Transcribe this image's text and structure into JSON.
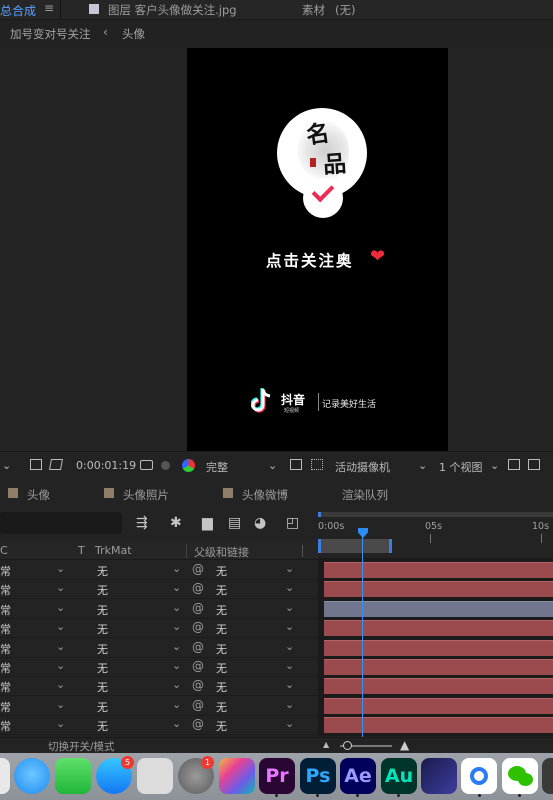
{
  "title_bar": {
    "active_tab": "总合成",
    "menu_glyph": "≡",
    "layer_tab": "图层 客户头像做关注.jpg",
    "footage_tab": "素材",
    "footage_value": "(无)"
  },
  "breadcrumb": {
    "item1": "加号变对号关注",
    "arrow": "‹",
    "item2": "头像"
  },
  "canvas": {
    "logo_char1": "名",
    "logo_char2": "品",
    "cta_text": "点击关注奥",
    "cta_heart": "❤",
    "app_name": "抖音",
    "app_sub": "短视频",
    "slogan": "记录美好生活"
  },
  "viewer_toolbar": {
    "timecode": "0:00:01:19",
    "resolution": "完整",
    "camera": "活动摄像机",
    "views": "1 个视图",
    "dropdown_glyph": "⌄"
  },
  "panel_tabs": [
    "头像",
    "头像照片",
    "头像微博",
    "渲染队列"
  ],
  "ruler": {
    "labels": [
      "0:00s",
      "05s",
      "10s"
    ]
  },
  "columns": {
    "mode": "C",
    "t": "T",
    "trkmat": "TrkMat",
    "parent": "父级和链接"
  },
  "layer_rows": [
    {
      "mode": "常",
      "trkmat": "无",
      "parent": "无",
      "selected": false
    },
    {
      "mode": "常",
      "trkmat": "无",
      "parent": "无",
      "selected": false
    },
    {
      "mode": "常",
      "trkmat": "无",
      "parent": "无",
      "selected": true
    },
    {
      "mode": "常",
      "trkmat": "无",
      "parent": "无",
      "selected": false
    },
    {
      "mode": "常",
      "trkmat": "无",
      "parent": "无",
      "selected": false
    },
    {
      "mode": "常",
      "trkmat": "无",
      "parent": "无",
      "selected": false
    },
    {
      "mode": "常",
      "trkmat": "无",
      "parent": "无",
      "selected": false
    },
    {
      "mode": "常",
      "trkmat": "无",
      "parent": "无",
      "selected": false
    },
    {
      "mode": "常",
      "trkmat": "无",
      "parent": "无",
      "selected": false
    }
  ],
  "bottom_bar": {
    "toggle_label": "切换开关/模式"
  },
  "dock": {
    "appstore_badge": "5",
    "prefs_badge": "1",
    "apps": [
      {
        "name": "premiere-icon",
        "label": "Pr",
        "color": "#ea77ff"
      },
      {
        "name": "photoshop-icon",
        "label": "Ps",
        "color": "#31a8ff"
      },
      {
        "name": "after-effects-icon",
        "label": "Ae",
        "color": "#9999ff"
      },
      {
        "name": "audition-icon",
        "label": "Au",
        "color": "#00e4bb"
      }
    ]
  },
  "colors": {
    "accent_blue": "#3b8ff0",
    "track_red": "#9b4a4e",
    "track_selected": "#71768e",
    "tiktok_pink": "#ee2a52"
  }
}
